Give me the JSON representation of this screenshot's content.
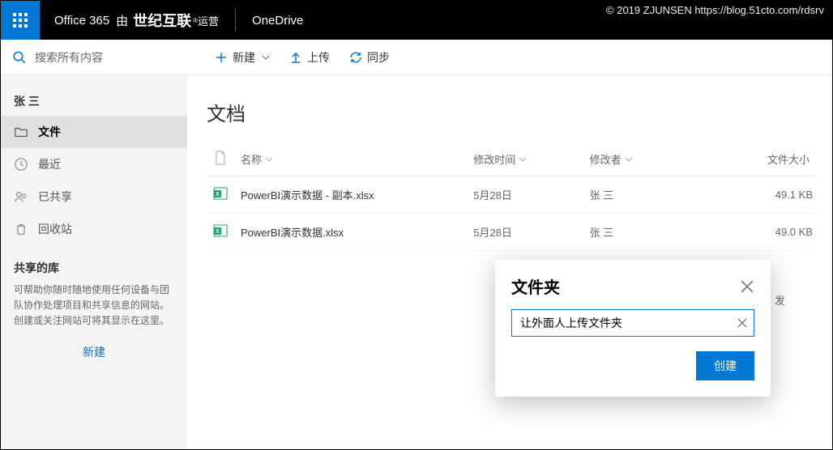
{
  "watermark": "© 2019 ZJUNSEN https://blog.51cto.com/rdsrv",
  "header": {
    "office_label": "Office 365",
    "operated_prefix": "由",
    "partner": "世纪互联",
    "operated_suffix": "运营",
    "app_name": "OneDrive"
  },
  "search": {
    "placeholder": "搜索所有内容"
  },
  "commands": {
    "new": "新建",
    "upload": "上传",
    "sync": "同步"
  },
  "sidebar": {
    "user": "张 三",
    "items": [
      {
        "label": "文件"
      },
      {
        "label": "最近"
      },
      {
        "label": "已共享"
      },
      {
        "label": "回收站"
      }
    ],
    "shared_header": "共享的库",
    "help_text": "可帮助你随时随地使用任何设备与团队协作处理项目和共享信息的网站。创建或关注网站可将其显示在这里。",
    "new_label": "新建"
  },
  "main": {
    "title": "文档",
    "columns": {
      "name": "名称",
      "modified": "修改时间",
      "modified_by": "修改者",
      "size": "文件大小"
    },
    "rows": [
      {
        "name": "PowerBI演示数据 - 副本.xlsx",
        "modified": "5月28日",
        "modified_by": "张 三",
        "size": "49.1 KB"
      },
      {
        "name": "PowerBI演示数据.xlsx",
        "modified": "5月28日",
        "modified_by": "张 三",
        "size": "49.0 KB"
      }
    ],
    "obscured_marker": "发"
  },
  "dialog": {
    "title": "文件夹",
    "input_value": "让外面人上传文件夹",
    "create_label": "创建"
  }
}
